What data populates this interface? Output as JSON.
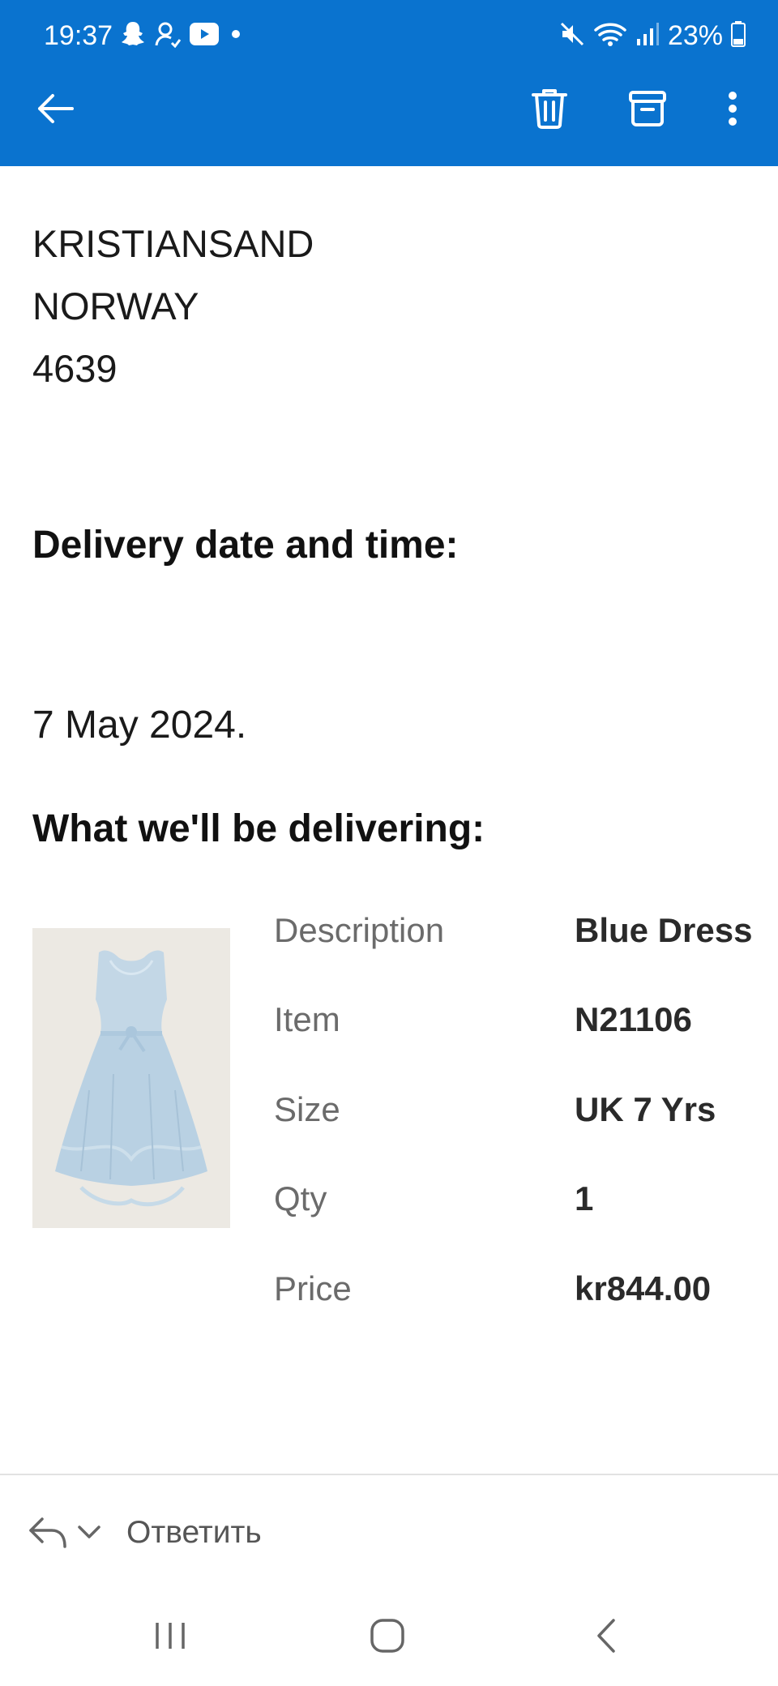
{
  "status_bar": {
    "time": "19:37",
    "battery": "23%",
    "icons_left": [
      "snapchat-icon",
      "contact-sync-icon",
      "youtube-icon",
      "dot-icon"
    ],
    "icons_right": [
      "mute-icon",
      "wifi-icon",
      "signal-icon",
      "battery-icon"
    ]
  },
  "toolbar": {
    "icons": [
      "back-arrow-icon",
      "delete-icon",
      "archive-icon",
      "more-vertical-icon"
    ],
    "accent_color": "#0a73cf"
  },
  "address": {
    "lines": [
      "KRISTIANSAND",
      "NORWAY",
      "4639"
    ]
  },
  "delivery": {
    "heading": "Delivery date and time:",
    "date": "7 May 2024."
  },
  "items": {
    "heading": "What we'll be delivering:",
    "image_icon": "blue-dress-image",
    "details": [
      {
        "label": "Description",
        "value": "Blue Dress"
      },
      {
        "label": "Item",
        "value": "N21106"
      },
      {
        "label": "Size",
        "value": "UK 7 Yrs"
      },
      {
        "label": "Qty",
        "value": "1"
      },
      {
        "label": "Price",
        "value": "kr844.00"
      }
    ]
  },
  "reply_bar": {
    "label": "Ответить",
    "icons": [
      "reply-icon",
      "chevron-down-icon"
    ]
  },
  "nav_bar": {
    "icons": [
      "recent-apps-icon",
      "home-icon",
      "back-icon"
    ]
  }
}
